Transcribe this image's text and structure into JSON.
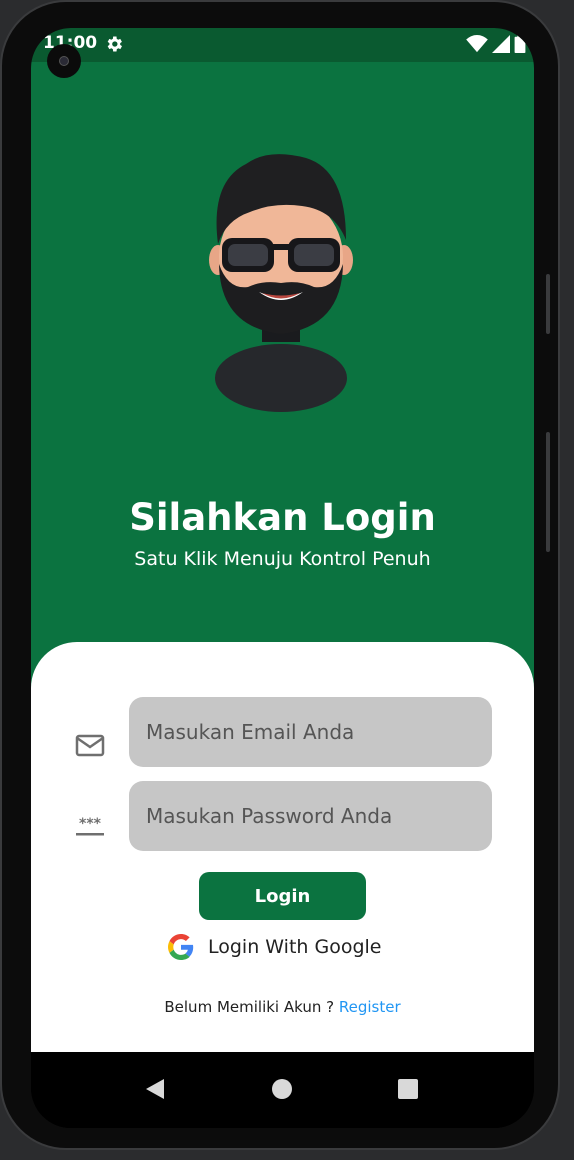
{
  "status_bar": {
    "time": "11:00",
    "icons": [
      "gear-icon",
      "wifi-icon",
      "signal-icon",
      "battery-icon"
    ]
  },
  "header": {
    "title": "Silahkan Login",
    "subtitle": "Satu Klik Menuju Kontrol Penuh"
  },
  "form": {
    "email_placeholder": "Masukan Email Anda",
    "password_placeholder": "Masukan Password Anda",
    "email_icon": "mail-icon",
    "password_icon": "password-icon",
    "login_label": "Login",
    "google_label": "Login With Google",
    "register_prompt": "Belum Memiliki Akun ? ",
    "register_link": "Register"
  },
  "navigation": [
    "back-icon",
    "home-icon",
    "recents-icon"
  ],
  "colors": {
    "primary": "#0b7340",
    "status_bar": "#0a5a30",
    "field": "#c6c6c6",
    "link": "#2196f3"
  }
}
